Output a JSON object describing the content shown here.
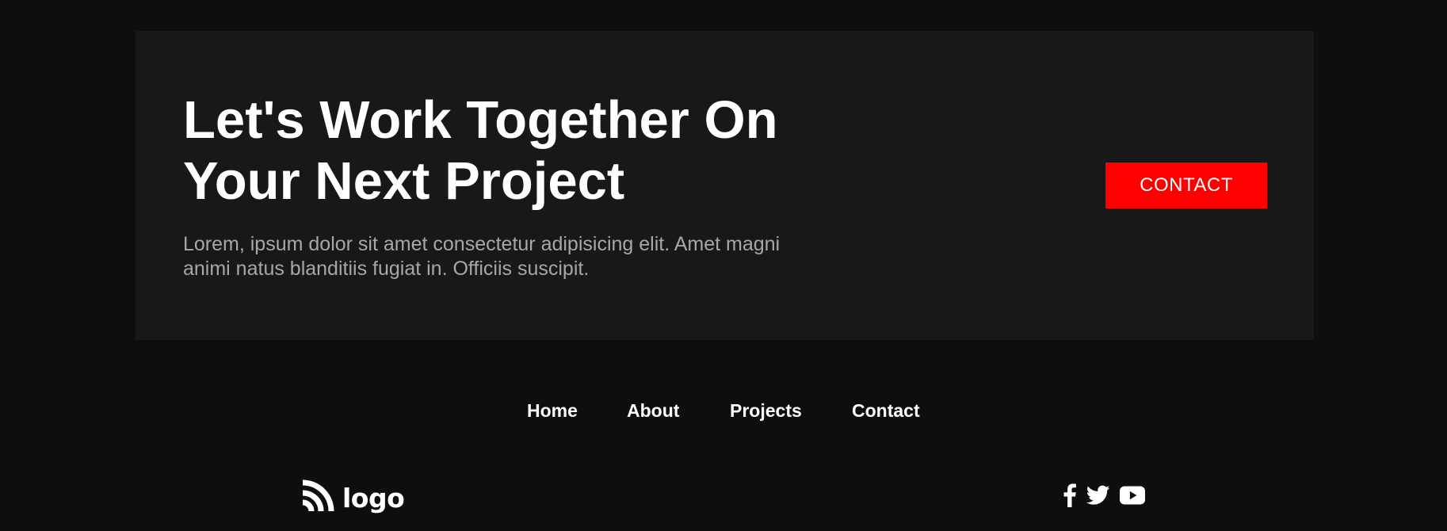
{
  "cta": {
    "heading": "Let's Work Together On Your Next Project",
    "paragraph": "Lorem, ipsum dolor sit amet consectetur adipisicing elit. Amet magni animi natus blanditiis fugiat in. Officiis suscipit.",
    "button_label": "CONTACT"
  },
  "footer": {
    "nav": [
      "Home",
      "About",
      "Projects",
      "Contact"
    ],
    "logo_text": "logo",
    "social_icons": [
      "facebook-icon",
      "twitter-icon",
      "youtube-icon"
    ]
  },
  "colors": {
    "page_bg": "#0e0e0e",
    "panel_bg": "#181818",
    "accent": "#ff0000",
    "text": "#ffffff",
    "muted_text": "#a7a7a7"
  }
}
